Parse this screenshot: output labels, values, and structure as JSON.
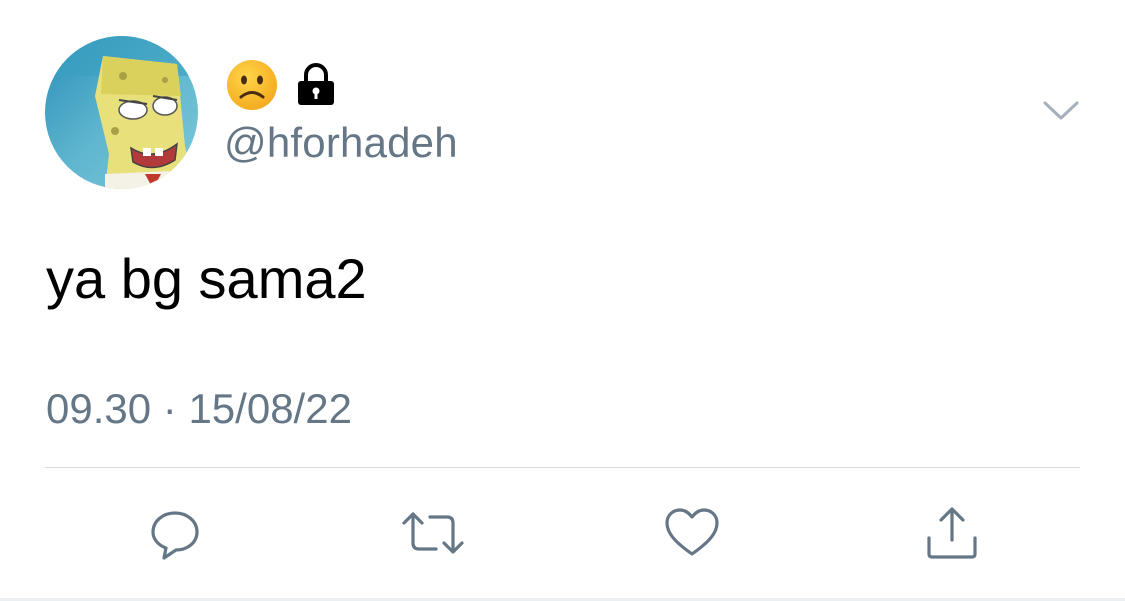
{
  "tweet": {
    "display_name_icons": [
      "frowning-face-icon",
      "lock-icon"
    ],
    "handle": "@hforhadeh",
    "text": "ya bg sama2",
    "time": "09.30",
    "separator": "·",
    "date": "15/08/22",
    "timestamp": "09.30 · 15/08/22"
  },
  "actions": [
    {
      "name": "reply",
      "icon": "reply-icon"
    },
    {
      "name": "retweet",
      "icon": "retweet-icon"
    },
    {
      "name": "like",
      "icon": "heart-icon"
    },
    {
      "name": "share",
      "icon": "share-icon"
    }
  ],
  "colors": {
    "secondary_text": "#657786",
    "icon_gray": "#657786",
    "divider": "#d6dbe0"
  }
}
